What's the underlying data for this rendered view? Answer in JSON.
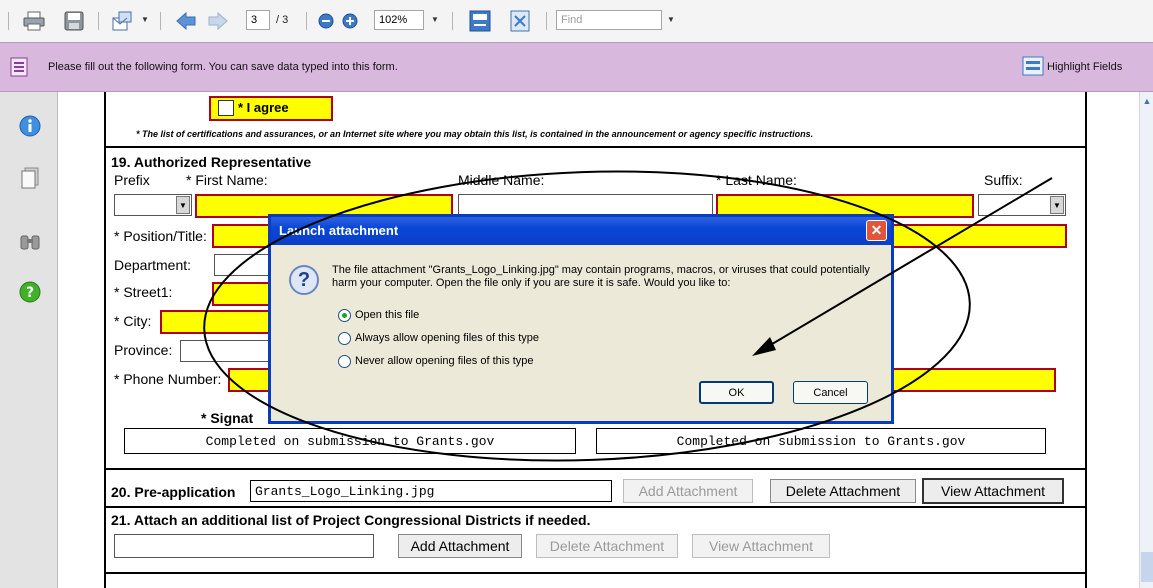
{
  "toolbar": {
    "page_current": "3",
    "page_total": "/ 3",
    "zoom": "102%",
    "find_placeholder": "Find",
    "icons": [
      "print-icon",
      "save-icon",
      "email-icon",
      "previous-page-icon",
      "next-page-icon",
      "zoom-out-icon",
      "zoom-in-icon",
      "fit-width-icon",
      "fit-page-icon"
    ]
  },
  "message_bar": {
    "text": "Please fill out the following form. You can save data typed into this form.",
    "highlight_label": "Highlight Fields"
  },
  "leftnav": {
    "icons": [
      "info-icon",
      "pages-icon",
      "binoculars-icon",
      "help-icon"
    ]
  },
  "form": {
    "agree_label": "* I agree",
    "cert_note": "* The list of certifications and assurances, or an Internet site where you may obtain this list, is contained in the announcement or agency specific instructions.",
    "section19_title": "19. Authorized Representative",
    "prefix_label": "Prefix",
    "first_name_label": "* First Name:",
    "middle_name_label": "Middle Name:",
    "last_name_label": "* Last Name:",
    "suffix_label": "Suffix:",
    "position_label": "* Position/Title:",
    "department_label": "Department:",
    "street1_label": "* Street1:",
    "city_label": "* City:",
    "province_label": "Province:",
    "phone_label": "* Phone Number:",
    "signature_label": "* Signat",
    "completed_text_1": "Completed on submission to Grants.gov",
    "completed_text_2": "Completed on submission to Grants.gov",
    "section20_label": "20. Pre-application",
    "preapp_file": "Grants_Logo_Linking.jpg",
    "add_attachment_label": "Add Attachment",
    "delete_attachment_label": "Delete Attachment",
    "view_attachment_label": "View Attachment",
    "section21_label": "21.  Attach an additional list of Project Congressional Districts if needed.",
    "add_attachment2_label": "Add Attachment",
    "delete_attachment2_label": "Delete Attachment",
    "view_attachment2_label": "View Attachment"
  },
  "dialog": {
    "title": "Launch attachment",
    "message": "The file attachment \"Grants_Logo_Linking.jpg\" may contain programs, macros, or viruses that could potentially harm your computer. Open the file only if you are sure it is safe. Would you like to:",
    "options": [
      "Open this file",
      "Always allow opening files of this type",
      "Never allow opening files of this type"
    ],
    "selected_option": "Open this file",
    "ok_label": "OK",
    "cancel_label": "Cancel"
  },
  "colors": {
    "required_field": "#ffff00",
    "required_border": "#b0001a",
    "message_bar": "#d9b8de",
    "dialog_title": "#0a46d6",
    "annotation": "#000000"
  }
}
